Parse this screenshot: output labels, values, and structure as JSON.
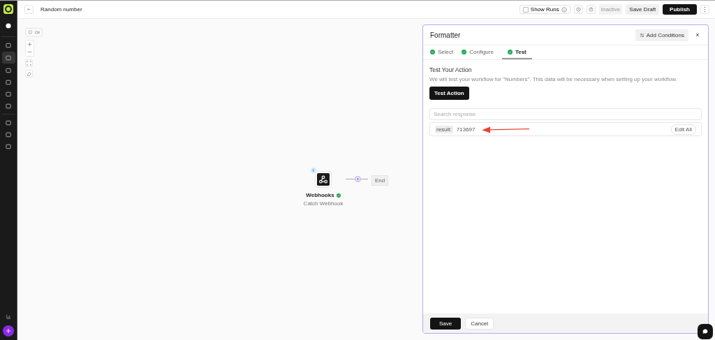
{
  "sidebar": {
    "items": [
      {
        "selected": false
      },
      {
        "selected": true
      },
      {
        "selected": false
      },
      {
        "selected": false
      },
      {
        "selected": false
      },
      {
        "selected": false
      },
      {
        "selected": false
      },
      {
        "selected": false
      },
      {
        "selected": false
      }
    ]
  },
  "header": {
    "title": "Random number",
    "show_runs": {
      "label": "Show Runs",
      "checked": false
    },
    "status": "Inactive",
    "save_draft": "Save Draft",
    "publish": "Publish"
  },
  "canvas": {
    "node": {
      "title": "Webhooks",
      "subtitle": "Catch Webhook",
      "done": true
    },
    "end_label": "End"
  },
  "panel": {
    "title": "Formatter",
    "add_conditions": "Add Conditions",
    "tabs": [
      {
        "label": "Select",
        "done": true,
        "selected": false
      },
      {
        "label": "Configure",
        "done": true,
        "selected": false
      },
      {
        "label": "Test",
        "done": true,
        "selected": true
      }
    ],
    "heading": "Test Your Action",
    "description": "We will test your workflow for \"Numbers\". This data will be necessary when setting up your workflow.",
    "test_button": "Test Action",
    "search": {
      "placeholder": "Search response"
    },
    "result": {
      "key": "result:",
      "value": "713697",
      "edit": "Edit All"
    },
    "save": "Save",
    "cancel": "Cancel"
  }
}
